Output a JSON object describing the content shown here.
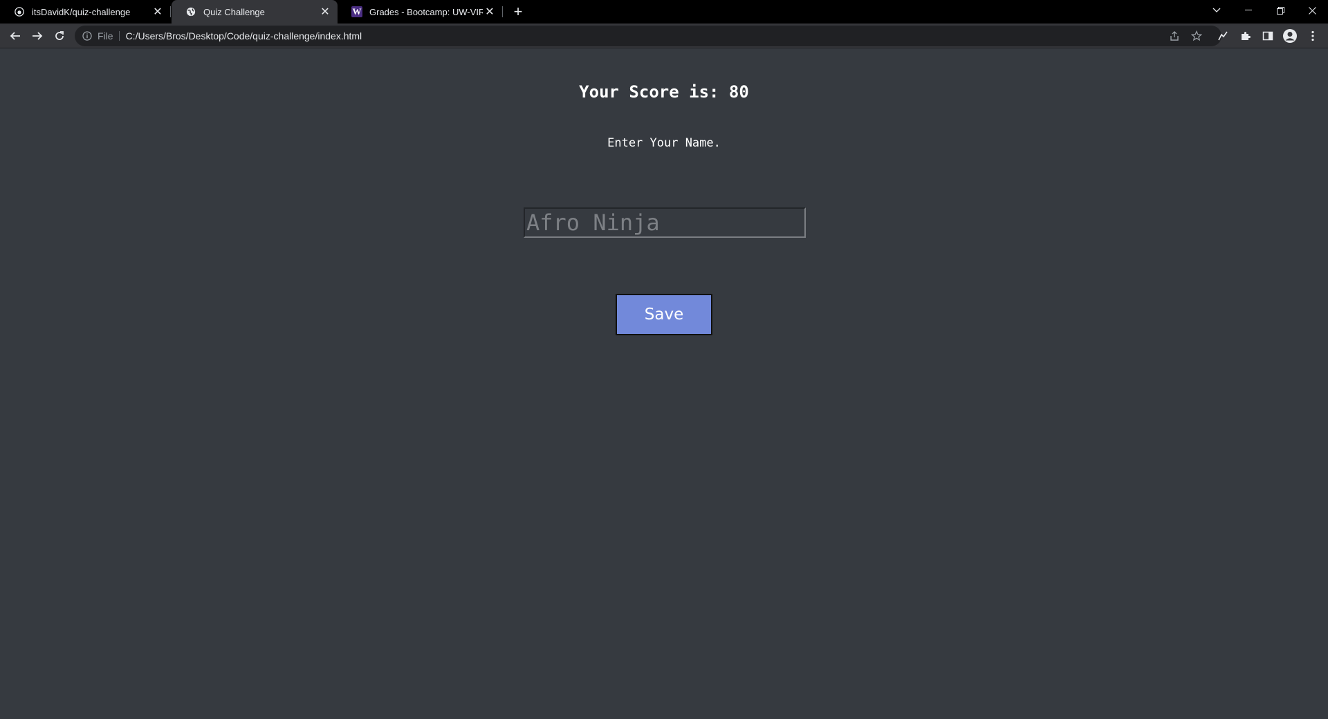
{
  "browser": {
    "tabs": [
      {
        "title": "itsDavidK/quiz-challenge",
        "favicon": "github-icon",
        "active": false
      },
      {
        "title": "Quiz Challenge",
        "favicon": "globe-icon",
        "active": true
      },
      {
        "title": "Grades - Bootcamp: UW-VIRT-FS",
        "favicon": "uw-w-icon",
        "active": false
      }
    ],
    "new_tab_label": "+",
    "omnibox": {
      "scheme_label": "File",
      "url": "C:/Users/Bros/Desktop/Code/quiz-challenge/index.html"
    },
    "icons": {
      "back": "back-arrow-icon",
      "forward": "forward-arrow-icon",
      "reload": "reload-icon",
      "info": "info-icon",
      "share": "share-icon",
      "bookmark": "star-icon",
      "extension_a": "pen-icon",
      "extensions": "puzzle-icon",
      "side_panel": "side-panel-icon",
      "profile": "profile-icon",
      "menu": "kebab-menu-icon"
    }
  },
  "page": {
    "score_text": "Your Score is: 80",
    "prompt_text": "Enter Your Name.",
    "name_input": {
      "value": "",
      "placeholder": "Afro Ninja"
    },
    "save_label": "Save"
  },
  "colors": {
    "page_background": "#363a40",
    "button_background": "#7289da",
    "text": "#ffffff"
  }
}
